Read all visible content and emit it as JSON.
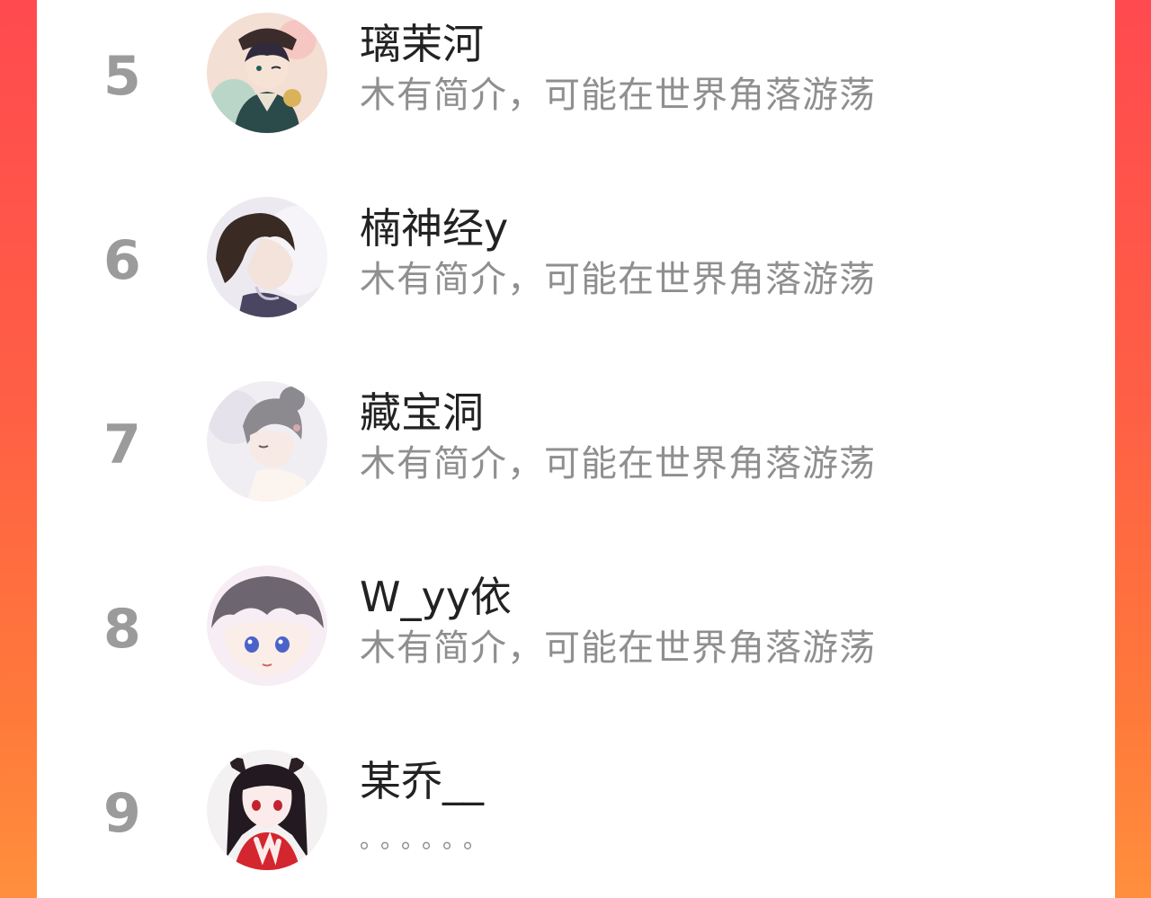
{
  "leaderboard": [
    {
      "rank": "5",
      "name": "璃茉河",
      "bio": "木有简介，可能在世界角落游荡",
      "avatar_icon": "anime-avatar-icon-captain-hat"
    },
    {
      "rank": "6",
      "name": "楠神经y",
      "bio": "木有简介，可能在世界角落游荡",
      "avatar_icon": "anime-avatar-icon-boy-profile"
    },
    {
      "rank": "7",
      "name": "藏宝洞",
      "bio": "木有简介，可能在世界角落游荡",
      "avatar_icon": "anime-avatar-icon-girl-bun"
    },
    {
      "rank": "8",
      "name": "W_yy依",
      "bio": "木有简介，可能在世界角落游荡",
      "avatar_icon": "anime-avatar-icon-boy-blue-eyes"
    },
    {
      "rank": "9",
      "name": "某乔__",
      "bio": "。。。。。。",
      "avatar_icon": "anime-avatar-icon-girl-horns"
    }
  ],
  "colors": {
    "background_gradient_top": "#ff4a4f",
    "background_gradient_bottom": "#ff8f3d",
    "card": "#ffffff",
    "rank_text": "#9b9b9b",
    "name_text": "#222222",
    "bio_text": "#8f8f8f"
  }
}
